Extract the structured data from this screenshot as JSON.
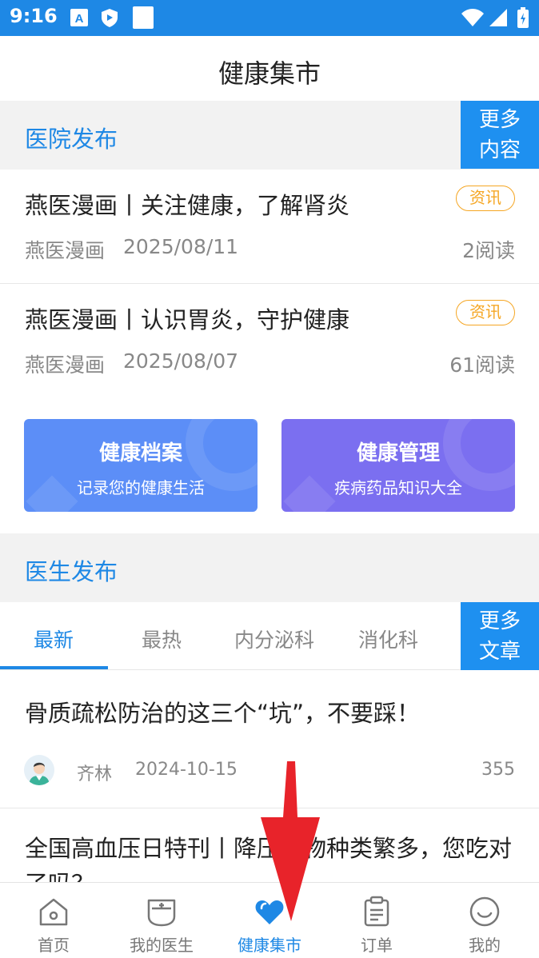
{
  "status_bar": {
    "time": "9:16",
    "left_icons": [
      "font-a-icon",
      "shield-icon",
      "square-icon"
    ],
    "right_icons": [
      "wifi-icon",
      "signal-icon",
      "battery-icon"
    ],
    "color": "#1e88e5"
  },
  "header": {
    "title": "健康集市"
  },
  "hospital_section": {
    "title": "医院发布",
    "more_line1": "更多",
    "more_line2": "内容",
    "items": [
      {
        "title": "燕医漫画丨关注健康，了解肾炎",
        "tag": "资讯",
        "source": "燕医漫画",
        "date": "2025/08/11",
        "reads": "2阅读"
      },
      {
        "title": "燕医漫画丨认识胃炎，守护健康",
        "tag": "资讯",
        "source": "燕医漫画",
        "date": "2025/08/07",
        "reads": "61阅读"
      }
    ]
  },
  "cards": [
    {
      "title": "健康档案",
      "subtitle": "记录您的健康生活",
      "color": "#5c8ef7"
    },
    {
      "title": "健康管理",
      "subtitle": "疾病药品知识大全",
      "color": "#7b6ff0"
    }
  ],
  "doctor_section": {
    "title": "医生发布",
    "more_line1": "更多",
    "more_line2": "文章",
    "tabs": [
      {
        "label": "最新",
        "active": true
      },
      {
        "label": "最热",
        "active": false
      },
      {
        "label": "内分泌科",
        "active": false
      },
      {
        "label": "消化科",
        "active": false
      }
    ],
    "articles": [
      {
        "title": "骨质疏松防治的这三个“坑”，不要踩！",
        "author": "齐林",
        "date": "2024-10-15",
        "views": "355"
      },
      {
        "title": "全国高血压日特刊丨降压药物种类繁多，您吃对了吗？"
      }
    ]
  },
  "bottom_nav": {
    "items": [
      {
        "label": "首页",
        "icon": "home-icon",
        "active": false
      },
      {
        "label": "我的医生",
        "icon": "doctor-bag-icon",
        "active": false
      },
      {
        "label": "健康集市",
        "icon": "heart-icon",
        "active": true
      },
      {
        "label": "订单",
        "icon": "clipboard-icon",
        "active": false
      },
      {
        "label": "我的",
        "icon": "smiley-icon",
        "active": false
      }
    ]
  },
  "colors": {
    "accent": "#1e88e5",
    "tag": "#f5a623",
    "annotation_arrow": "#e8232a"
  }
}
